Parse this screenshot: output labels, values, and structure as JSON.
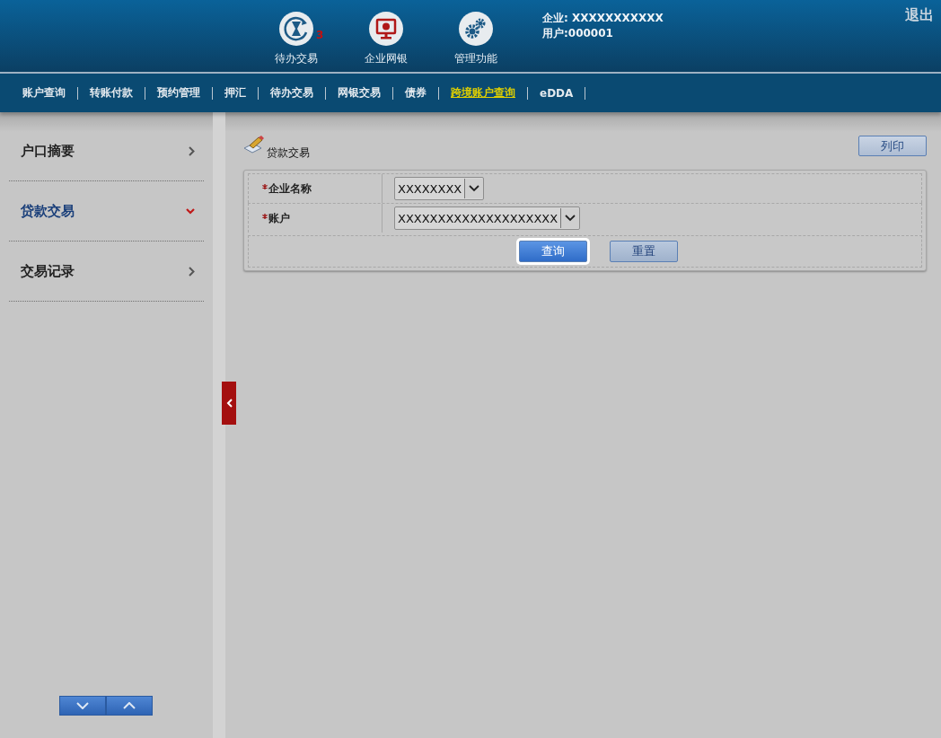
{
  "header": {
    "quick_links": [
      {
        "kind": "pending",
        "label": "待办交易",
        "badge": "3"
      },
      {
        "kind": "bank",
        "label": "企业网银"
      },
      {
        "kind": "admin",
        "label": "管理功能"
      }
    ],
    "company": "企业: XXXXXXXXXXX",
    "user": "用户:000001",
    "logout": "退出"
  },
  "nav": [
    {
      "label": "账户查询",
      "selected": false
    },
    {
      "label": "转账付款",
      "selected": false
    },
    {
      "label": "预约管理",
      "selected": false
    },
    {
      "label": "押汇",
      "selected": false
    },
    {
      "label": "待办交易",
      "selected": false
    },
    {
      "label": "网银交易",
      "selected": false
    },
    {
      "label": "债券",
      "selected": false
    },
    {
      "label": "跨境账户查询",
      "selected": true
    },
    {
      "label": "eDDA",
      "selected": false
    }
  ],
  "sidebar": {
    "items": [
      {
        "label": "户口摘要",
        "expanded": false
      },
      {
        "label": "贷款交易",
        "expanded": true
      },
      {
        "label": "交易记录",
        "expanded": false
      }
    ]
  },
  "panel": {
    "title": "贷款交易",
    "print_button": "列印",
    "fields": [
      {
        "label": "企业名称",
        "required": true,
        "value": "XXXXXXXX"
      },
      {
        "label": "账户",
        "required": true,
        "value": "XXXXXXXXXXXXXXXXXXXX"
      }
    ],
    "buttons": [
      {
        "label": "查询",
        "kind": "primary"
      },
      {
        "label": "重置",
        "kind": "secondary"
      }
    ]
  }
}
